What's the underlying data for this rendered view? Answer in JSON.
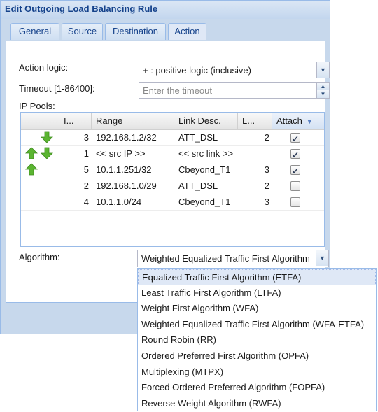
{
  "window": {
    "title": "Edit Outgoing Load Balancing Rule"
  },
  "tabs": [
    {
      "label": "General"
    },
    {
      "label": "Source"
    },
    {
      "label": "Destination"
    },
    {
      "label": "Action"
    }
  ],
  "form": {
    "action_logic_label": "Action logic:",
    "action_logic_value": "+ : positive logic (inclusive)",
    "timeout_label": "Timeout [1-86400]:",
    "timeout_placeholder": "Enter the timeout",
    "ip_pools_label": "IP Pools:",
    "algorithm_label": "Algorithm:",
    "algorithm_value": "Weighted Equalized Traffic First Algorithm"
  },
  "grid": {
    "columns": [
      "I...",
      "Range",
      "Link Desc.",
      "L...",
      "Attach"
    ],
    "sorted_column": "Attach",
    "rows": [
      {
        "arrows": [
          "down"
        ],
        "index": "3",
        "range": "192.168.1.2/32",
        "link": "ATT_DSL",
        "l": "2",
        "attach": true
      },
      {
        "arrows": [
          "up",
          "down"
        ],
        "index": "1",
        "range": "<< src IP >>",
        "link": "<< src link >>",
        "l": "",
        "attach": true
      },
      {
        "arrows": [
          "up"
        ],
        "index": "5",
        "range": "10.1.1.251/32",
        "link": "Cbeyond_T1",
        "l": "3",
        "attach": true
      },
      {
        "arrows": [],
        "index": "2",
        "range": "192.168.1.0/29",
        "link": "ATT_DSL",
        "l": "2",
        "attach": false
      },
      {
        "arrows": [],
        "index": "4",
        "range": "10.1.1.0/24",
        "link": "Cbeyond_T1",
        "l": "3",
        "attach": false
      }
    ]
  },
  "algorithm_options": [
    "Equalized Traffic First Algorithm (ETFA)",
    "Least Traffic First Algorithm (LTFA)",
    "Weight First Algorithm (WFA)",
    "Weighted Equalized Traffic First Algorithm (WFA-ETFA)",
    "Round Robin (RR)",
    "Ordered Preferred First Algorithm (OPFA)",
    "Multiplexing (MTPX)",
    "Forced Ordered Preferred Algorithm (FOPFA)",
    "Reverse Weight Algorithm (RWFA)"
  ],
  "algorithm_highlighted": "Equalized Traffic First Algorithm (ETFA)",
  "colors": {
    "window_bg": "#c7d8ec",
    "accent_text": "#15428b",
    "arrow_green": "#5bb531",
    "selection_bg": "#dfe8f6"
  },
  "icons": {
    "move_up": "green-up-arrow-icon",
    "move_down": "green-down-arrow-icon",
    "combo_trigger": "chevron-down-icon",
    "sort": "sort-desc-icon"
  }
}
